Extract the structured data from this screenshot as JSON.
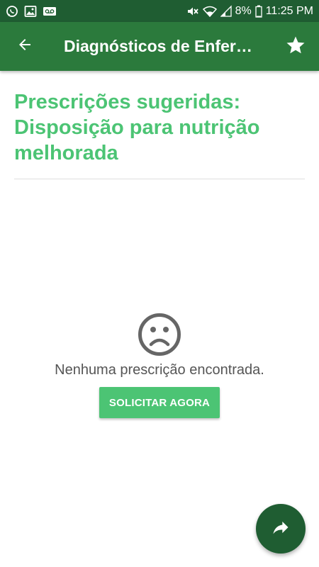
{
  "status_bar": {
    "battery": "8%",
    "time": "11:25 PM",
    "icons": [
      "whatsapp-icon",
      "image-icon",
      "voicemail-icon",
      "mute-icon",
      "wifi-icon",
      "signal-icon",
      "battery-icon"
    ]
  },
  "app_bar": {
    "title": "Diagnósticos de Enfer…",
    "back_icon": "arrow-back-icon",
    "favorite_icon": "star-icon"
  },
  "main": {
    "heading": "Prescrições sugeridas: Disposição para nutrição melhorada",
    "empty_state": {
      "icon": "sad-face-icon",
      "message": "Nenhuma prescrição encontrada.",
      "button_label": "SOLICITAR AGORA"
    },
    "fab_icon": "share-icon"
  },
  "colors": {
    "status_bar_bg": "#1f5d32",
    "app_bar_bg": "#2b7a3c",
    "accent": "#4cc474",
    "fab_bg": "#1f5d32",
    "text_gray": "#555555"
  }
}
